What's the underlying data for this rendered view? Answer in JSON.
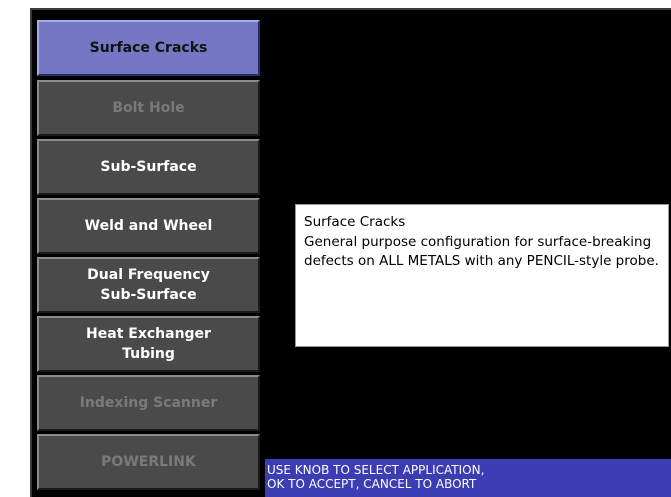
{
  "menu": {
    "items": [
      {
        "lines": [
          "Surface Cracks"
        ],
        "state": "selected"
      },
      {
        "lines": [
          "Bolt Hole"
        ],
        "state": "disabled"
      },
      {
        "lines": [
          "Sub-Surface"
        ],
        "state": "enabled"
      },
      {
        "lines": [
          "Weld and Wheel"
        ],
        "state": "enabled"
      },
      {
        "lines": [
          "Dual Frequency",
          "Sub-Surface"
        ],
        "state": "enabled"
      },
      {
        "lines": [
          "Heat Exchanger",
          "Tubing"
        ],
        "state": "enabled"
      },
      {
        "lines": [
          "Indexing Scanner"
        ],
        "state": "disabled"
      },
      {
        "lines": [
          "POWERLINK"
        ],
        "state": "disabled"
      }
    ]
  },
  "description": {
    "title": "Surface Cracks",
    "body": "General purpose configuration for surface-breaking defects on ALL METALS with any PENCIL-style probe."
  },
  "status": {
    "line1": "USE KNOB TO SELECT APPLICATION,",
    "line2": "OK TO ACCEPT, CANCEL TO ABORT"
  },
  "colors": {
    "selected": "#7478c4",
    "button": "#4a4a4a",
    "status_bar": "#3c3cb4",
    "screen": "#000000"
  }
}
